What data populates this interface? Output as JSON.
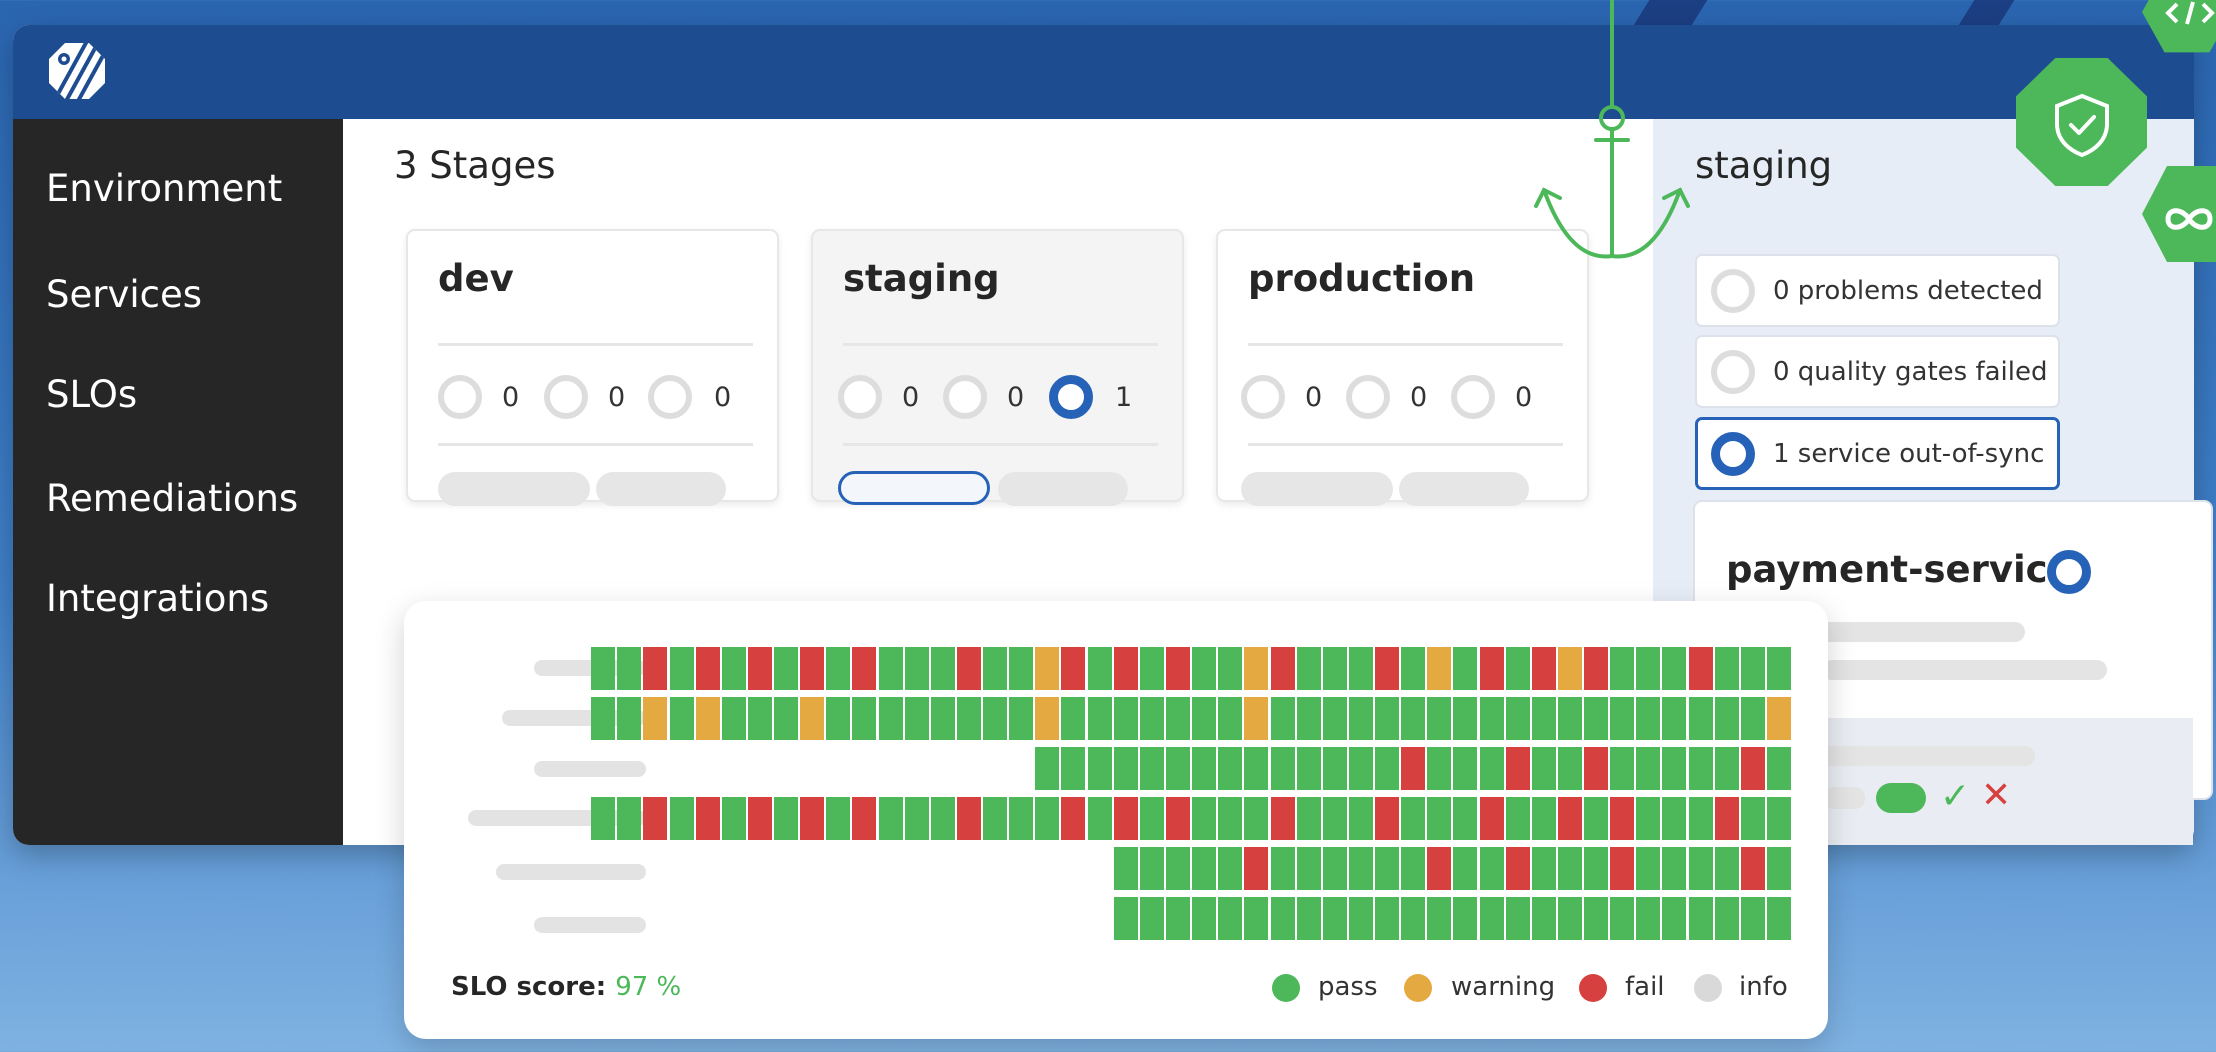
{
  "nav": {
    "items": [
      {
        "label": "Environment",
        "icon": "environment-icon"
      },
      {
        "label": "Services",
        "icon": "services-icon"
      },
      {
        "label": "SLOs",
        "icon": "slos-icon"
      },
      {
        "label": "Remediations",
        "icon": "remediations-icon"
      },
      {
        "label": "Integrations",
        "icon": "integrations-icon"
      }
    ]
  },
  "main": {
    "title": "3 Stages",
    "stages": [
      {
        "name": "dev",
        "counts": [
          "0",
          "0",
          "0"
        ],
        "active": false
      },
      {
        "name": "staging",
        "counts": [
          "0",
          "0",
          "1"
        ],
        "active": true
      },
      {
        "name": "production",
        "counts": [
          "0",
          "0",
          "0"
        ],
        "active": false
      }
    ]
  },
  "panel": {
    "title": "staging",
    "statuses": [
      {
        "text": "0 problems detected",
        "active": false
      },
      {
        "text": "0 quality gates failed",
        "active": false
      },
      {
        "text": "1 service out-of-sync",
        "active": true
      }
    ],
    "service": {
      "name": "payment-service"
    }
  },
  "slo": {
    "score_label": "SLO score:",
    "score_value": "97 %",
    "legend": [
      {
        "label": "pass",
        "color": "#4cb85a"
      },
      {
        "label": "warning",
        "color": "#e5a941"
      },
      {
        "label": "fail",
        "color": "#d6403e"
      },
      {
        "label": "info",
        "color": "#d9d9d9"
      }
    ],
    "rows": [
      "GGRGRGRGRGRGGGRGGWRGRGRGGWRGGGRGWGRGRWRGGGRGGG",
      "GGWGWGGGWGGGGGGGGWGGGGGGGWGGGGGGGGGGGGGGGGGGGW",
      "GGGGGGGGGGGGGGRGGGRGGRGGGGGRG",
      "GGRGRGRGRGRGGGRGGGRGRGRGGGRGGGRGGGRGGRGRGGGRGG",
      "GGGGGRGGGGGGRGGRGGGRGGGGRG",
      "GGGGGGGGGGGGGGGGGGGGGGGGGG"
    ]
  },
  "colors": {
    "accent": "#2662b8",
    "topbar": "#1e4c91",
    "sidebar": "#262626",
    "pass": "#4cb85a",
    "warning": "#e5a941",
    "fail": "#d6403e"
  }
}
